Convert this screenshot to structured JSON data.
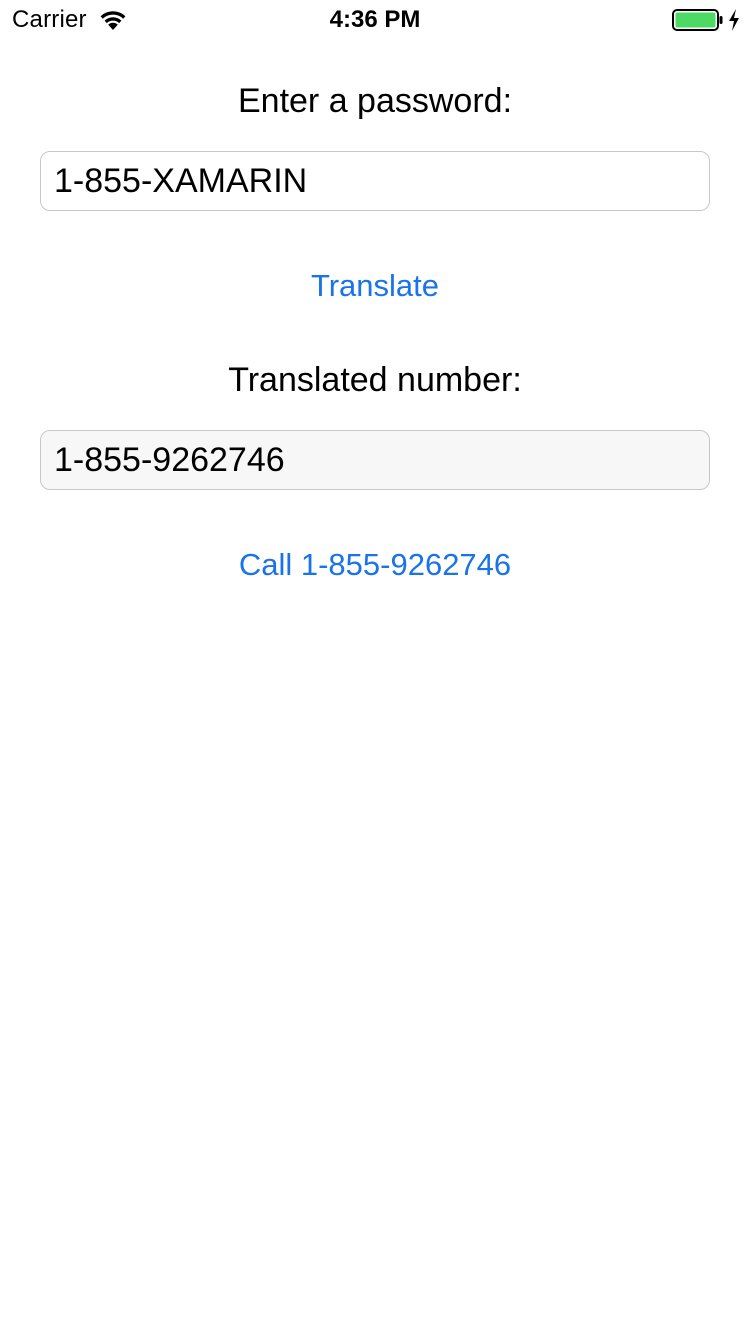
{
  "status_bar": {
    "carrier": "Carrier",
    "time": "4:36 PM",
    "wifi_icon": "wifi-icon",
    "battery_icon": "battery-full-icon",
    "charging_icon": "lightning-bolt-icon",
    "battery_color": "#4cd964"
  },
  "form": {
    "password_label": "Enter a password:",
    "password_value": "1-855-XAMARIN",
    "translate_button": "Translate",
    "translated_label": "Translated number:",
    "translated_value": "1-855-9262746",
    "call_button": "Call 1-855-9262746"
  },
  "colors": {
    "accent": "#1a73e8",
    "field_border": "#c8c8cc",
    "readonly_field_bg": "#f7f7f7"
  }
}
